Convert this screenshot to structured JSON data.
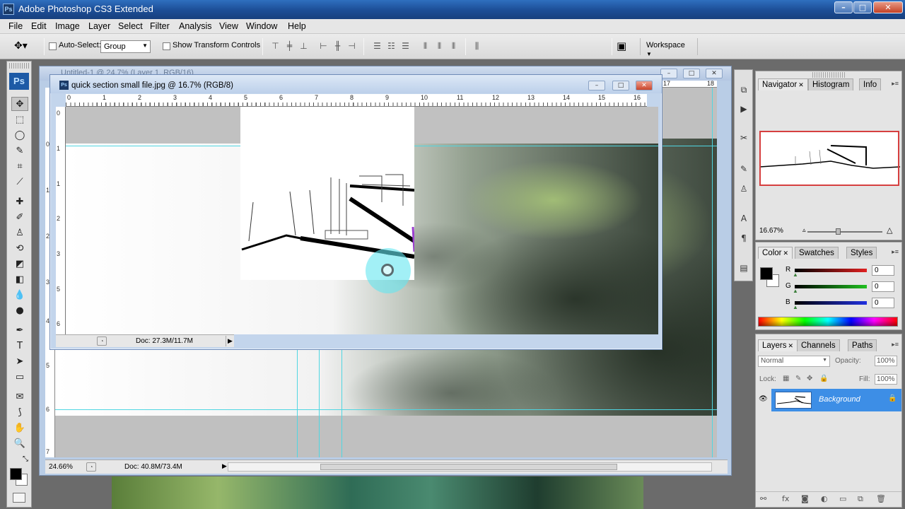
{
  "app": {
    "title": "Adobe Photoshop CS3 Extended",
    "logo": "Ps"
  },
  "window_controls": [
    "minimize-icon",
    "maximize-icon",
    "close-icon"
  ],
  "menu": [
    "File",
    "Edit",
    "Image",
    "Layer",
    "Select",
    "Filter",
    "Analysis",
    "View",
    "Window",
    "Help"
  ],
  "options_bar": {
    "auto_select_label": "Auto-Select:",
    "auto_select_value": "Group",
    "show_transform_label": "Show Transform Controls",
    "workspace_label": "Workspace"
  },
  "tools": [
    "move",
    "marquee",
    "lasso",
    "quick-select",
    "crop",
    "slice",
    "healing",
    "brush",
    "clone-stamp",
    "history-brush",
    "eraser",
    "gradient",
    "blur",
    "dodge",
    "pen",
    "type",
    "path-select",
    "shape",
    "notes",
    "eyedropper",
    "hand",
    "zoom"
  ],
  "back_document": {
    "title": "Untitled-1 @ 24.7% (Layer 1, RGB/16)",
    "zoom": "24.66%",
    "doc_size": "Doc: 40.8M/73.4M",
    "ruler_left": [
      "0",
      "1",
      "2",
      "3",
      "4",
      "5",
      "6",
      "7"
    ],
    "ruler_top_right": [
      "17",
      "18"
    ]
  },
  "front_document": {
    "title": "quick section small file.jpg @ 16.7% (RGB/8)",
    "doc_size": "Doc: 27.3M/11.7M",
    "ruler_top": [
      "0",
      "1",
      "2",
      "3",
      "4",
      "5",
      "6",
      "7",
      "8",
      "9",
      "10",
      "11",
      "12",
      "13",
      "14",
      "15",
      "16"
    ],
    "ruler_left": [
      "0",
      "1",
      "2",
      "3",
      "4",
      "5",
      "6"
    ]
  },
  "navigator_panel": {
    "tabs": [
      "Navigator",
      "Histogram",
      "Info"
    ],
    "zoom": "16.67%",
    "view_box_color": "#d63f3f"
  },
  "color_panel": {
    "tabs": [
      "Color",
      "Swatches",
      "Styles"
    ],
    "channels": [
      {
        "label": "R",
        "value": "0",
        "color": "#e02020"
      },
      {
        "label": "G",
        "value": "0",
        "color": "#20c020"
      },
      {
        "label": "B",
        "value": "0",
        "color": "#2030e0"
      }
    ]
  },
  "layers_panel": {
    "tabs": [
      "Layers",
      "Channels",
      "Paths"
    ],
    "blend_mode": "Normal",
    "opacity_label": "Opacity:",
    "opacity_value": "100%",
    "lock_label": "Lock:",
    "fill_label": "Fill:",
    "fill_value": "100%",
    "layers": [
      {
        "name": "Background",
        "locked": true,
        "visible": true
      }
    ]
  },
  "colors": {
    "accent": "#3d8ee6",
    "guide": "#4fd6e2",
    "titlebar": "#1c4d95"
  }
}
